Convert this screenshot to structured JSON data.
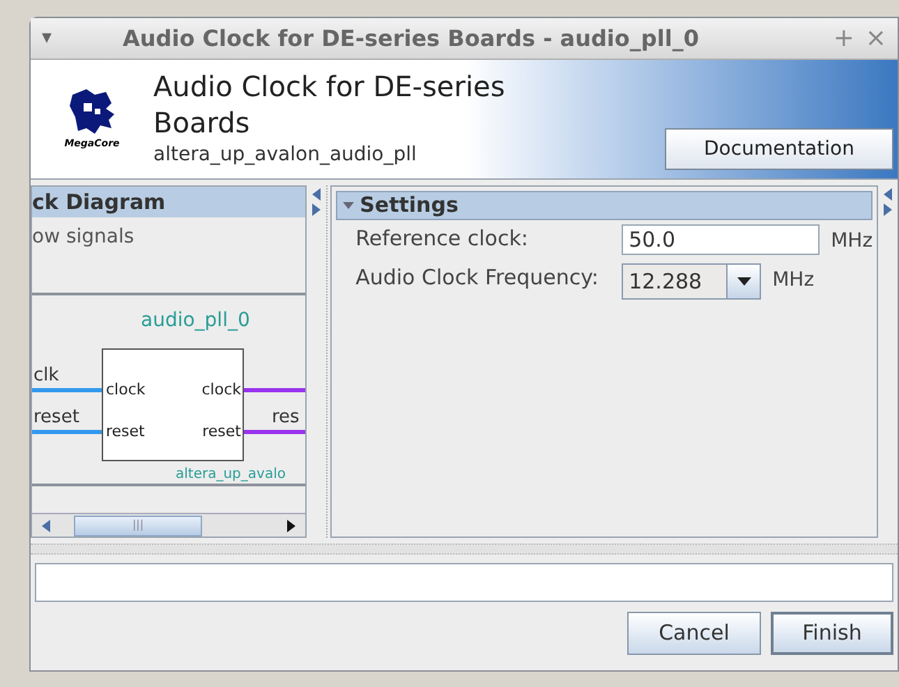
{
  "window": {
    "title": "Audio Clock for DE-series Boards - audio_pll_0",
    "menu_glyph": "▾",
    "pin_glyph": "+",
    "close_glyph": "×"
  },
  "header": {
    "logo_text": "MegaCore",
    "title": "Audio Clock for DE-series Boards",
    "subtitle": "altera_up_avalon_audio_pll",
    "documentation_button": "Documentation"
  },
  "block_diagram": {
    "title": "ck Diagram",
    "show_signals": "ow signals",
    "instance_name": "audio_pll_0",
    "component_type": "altera_up_avalo",
    "left_signals": [
      "clk",
      "reset"
    ],
    "right_signal": "res",
    "input_ports": [
      "clock",
      "reset"
    ],
    "output_ports": [
      "clock",
      "reset"
    ],
    "scroll_grip": "|||"
  },
  "settings": {
    "title": "Settings",
    "expanded": true,
    "fields": [
      {
        "kind": "text",
        "label": "Reference clock:",
        "value": "50.0",
        "unit": "MHz"
      },
      {
        "kind": "combo",
        "label": "Audio Clock Frequency:",
        "value": "12.288",
        "unit": "MHz"
      }
    ]
  },
  "buttons": [
    {
      "label": "Cancel",
      "default": false
    },
    {
      "label": "Finish",
      "default": true
    }
  ]
}
